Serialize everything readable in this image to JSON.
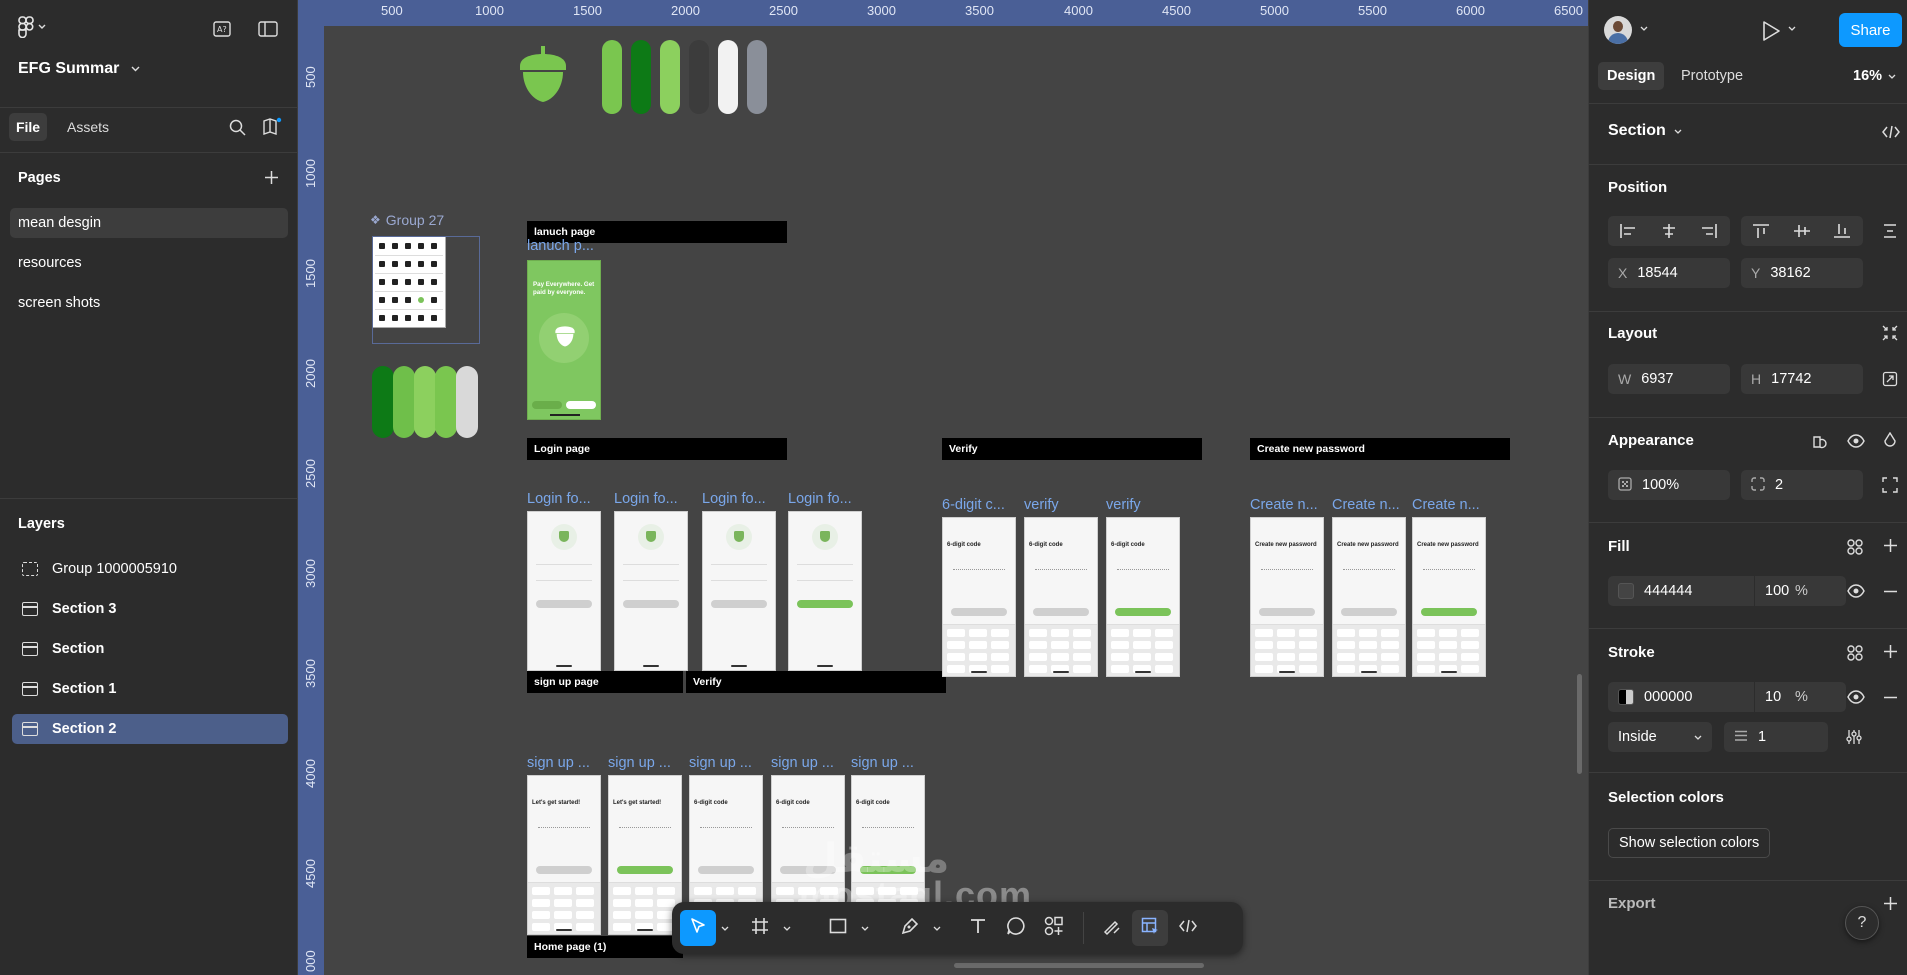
{
  "file": {
    "title": "EFG Summar"
  },
  "left_tabs": {
    "file": "File",
    "assets": "Assets"
  },
  "pages": {
    "heading": "Pages",
    "items": [
      "mean desgin",
      "resources",
      "screen shots"
    ]
  },
  "layers": {
    "heading": "Layers",
    "items": [
      "Group 1000005910",
      "Section 3",
      "Section",
      "Section 1",
      "Section 2"
    ]
  },
  "ruler": {
    "top": [
      "500",
      "1000",
      "1500",
      "2000",
      "2500",
      "3000",
      "3500",
      "4000",
      "4500",
      "5000",
      "5500",
      "6000",
      "6500"
    ],
    "left": [
      "500",
      "1000",
      "1500",
      "2000",
      "2500",
      "3000",
      "3500",
      "4000",
      "4500",
      "000"
    ]
  },
  "canvas": {
    "group_label": "Group 27",
    "sections": {
      "launch": "lanuch page",
      "login": "Login page",
      "verify": "Verify",
      "create": "Create new password",
      "signup": "sign up page",
      "verify2": "Verify",
      "home": "Home page (1)"
    },
    "frame_labels": {
      "launch": [
        "lanuch p..."
      ],
      "login": [
        "Login fo...",
        "Login fo...",
        "Login fo...",
        "Login fo..."
      ],
      "verify": [
        "6-digit c...",
        "verify",
        "verify"
      ],
      "create": [
        "Create n...",
        "Create n...",
        "Create n..."
      ],
      "signup": [
        "sign up ...",
        "sign up ...",
        "sign up ...",
        "sign up ...",
        "sign up ..."
      ]
    },
    "frame_titles": {
      "launch_text": "Pay Everywhere. Get paid by everyone.",
      "verify": "6-digit code",
      "create": "Create new password",
      "signup": [
        "Let's get started!",
        "Let's get started!",
        "6-digit code",
        "6-digit code",
        "6-digit code"
      ]
    },
    "palette_colors": [
      "#7ac64f",
      "#0d7a16",
      "#8cd05e",
      "#3c3c3c",
      "#f2f2f2",
      "#8a8f99"
    ],
    "group_colors": [
      "#0d7a16",
      "#6fbf4a",
      "#8cd05e",
      "#7ac64f",
      "#d9d9d9"
    ]
  },
  "watermark": "mostaql.com",
  "right": {
    "tabs": {
      "design": "Design",
      "prototype": "Prototype"
    },
    "zoom": "16%",
    "share": "Share",
    "selection": "Section",
    "position": {
      "heading": "Position",
      "x_label": "X",
      "x": "18544",
      "y_label": "Y",
      "y": "38162"
    },
    "layout": {
      "heading": "Layout",
      "w_label": "W",
      "w": "6937",
      "h_label": "H",
      "h": "17742"
    },
    "appearance": {
      "heading": "Appearance",
      "opacity": "100%",
      "radius": "2"
    },
    "fill": {
      "heading": "Fill",
      "hex": "444444",
      "opacity": "100",
      "unit": "%"
    },
    "stroke": {
      "heading": "Stroke",
      "hex": "000000",
      "opacity": "10",
      "unit": "%",
      "position": "Inside",
      "weight": "1"
    },
    "selection_colors": {
      "heading": "Selection colors",
      "button": "Show selection colors"
    },
    "export": {
      "heading": "Export"
    },
    "help": "?"
  },
  "colors": {
    "accent": "#0d99ff",
    "ruler": "#4a5f96",
    "selected_layer": "#4c5f8a",
    "canvas": "#444444"
  }
}
